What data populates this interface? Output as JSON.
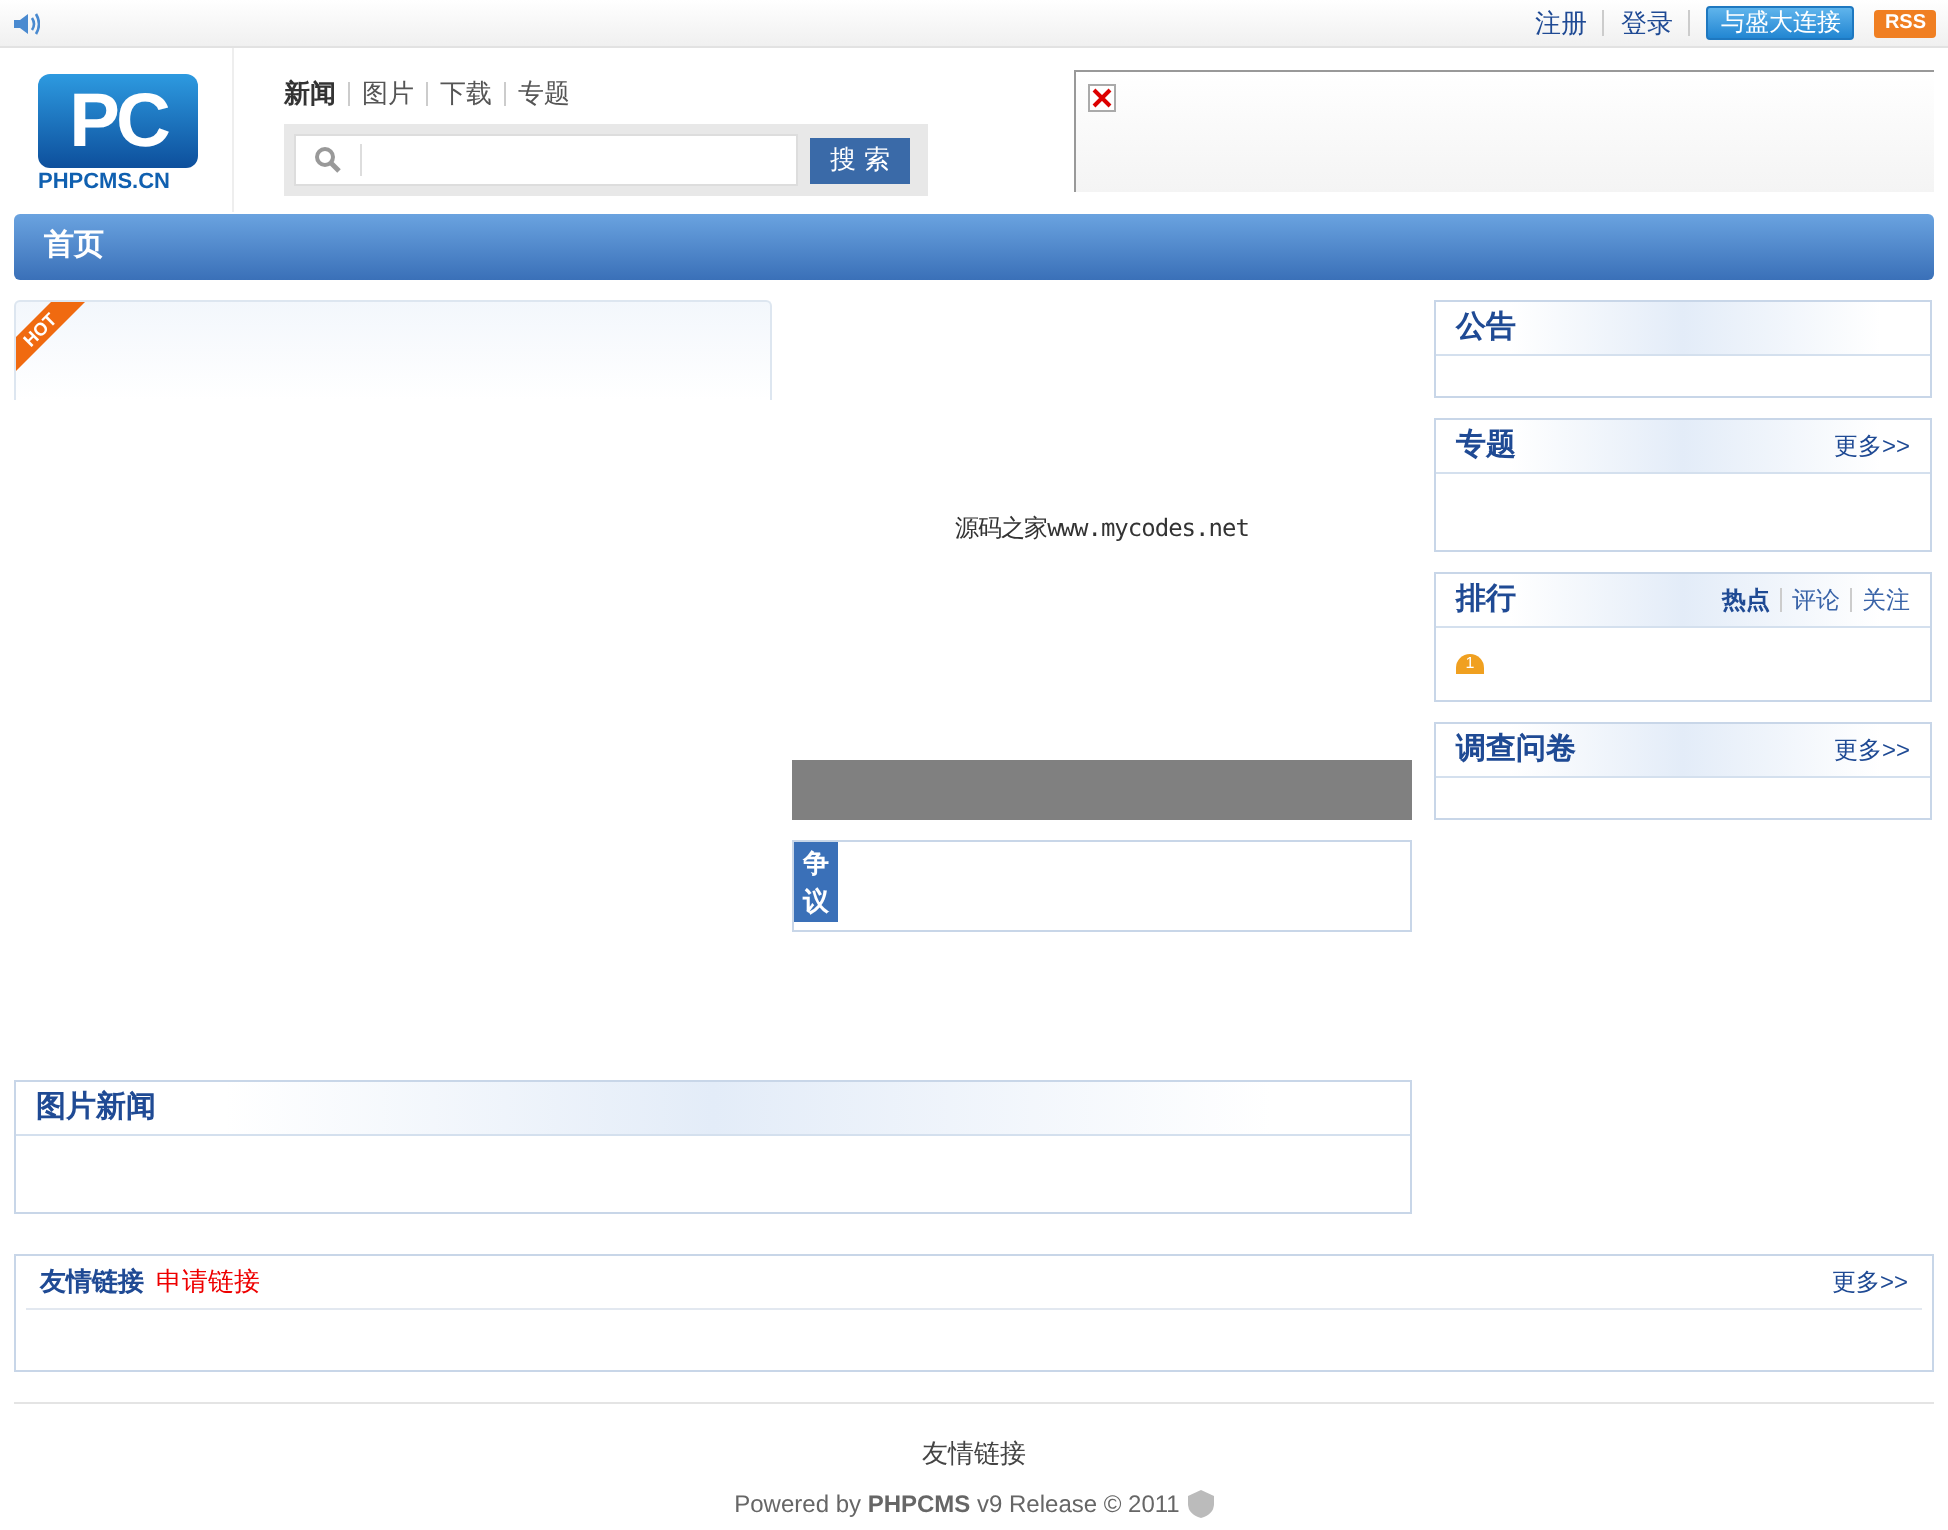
{
  "top_bar": {
    "links": [
      "注册",
      "登录"
    ],
    "connect_button": "与盛大连接",
    "rss": "RSS"
  },
  "logo": {
    "mark": "PC",
    "caption": "PHPCMS.CN"
  },
  "channel_tabs": [
    {
      "label": "新闻",
      "selected": true
    },
    {
      "label": "图片",
      "selected": false
    },
    {
      "label": "下载",
      "selected": false
    },
    {
      "label": "专题",
      "selected": false
    }
  ],
  "search": {
    "button": "搜 索"
  },
  "main_nav": [
    {
      "label": "首页",
      "selected": true
    }
  ],
  "hot_box": {
    "badge": "HOT"
  },
  "slideshow": {
    "caption": "源码之家www.mycodes.net"
  },
  "dispute": {
    "label": "争议"
  },
  "picture_news": {
    "title": "图片新闻"
  },
  "right_panels": [
    {
      "kind": "plain",
      "title": "公告"
    },
    {
      "kind": "more",
      "title": "专题",
      "more": "更多>>"
    },
    {
      "kind": "ranking",
      "title": "排行",
      "tabs": [
        {
          "label": "热点",
          "selected": true
        },
        {
          "label": "评论",
          "selected": false
        },
        {
          "label": "关注",
          "selected": false
        }
      ],
      "rank": "1"
    },
    {
      "kind": "more",
      "title": "调查问卷",
      "more": "更多>>"
    }
  ],
  "friend_links": {
    "title": "友情链接",
    "apply": "申请链接",
    "more": "更多>>"
  },
  "footer": {
    "link": "友情链接",
    "powered": "Powered by **PHPCMS** v9 Release © 2011"
  }
}
